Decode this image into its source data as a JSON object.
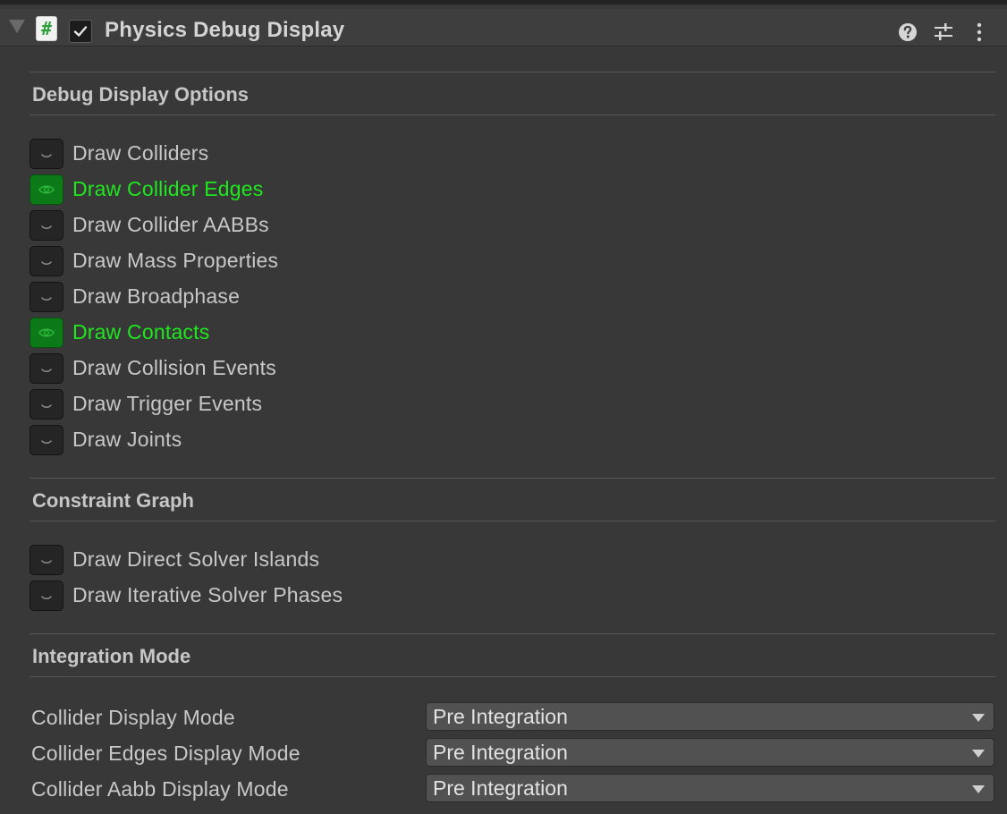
{
  "header": {
    "title": "Physics Debug Display",
    "script_icon_glyph": "#",
    "enabled": true,
    "icons": [
      "triangle-down-icon",
      "script-icon",
      "checkbox-icon",
      "help-icon",
      "sliders-icon",
      "vertical-ellipsis-icon"
    ]
  },
  "sections": {
    "debug_display": {
      "title": "Debug Display Options",
      "items": [
        {
          "label": "Draw Colliders",
          "on": false
        },
        {
          "label": "Draw Collider Edges",
          "on": true
        },
        {
          "label": "Draw Collider AABBs",
          "on": false
        },
        {
          "label": "Draw Mass Properties",
          "on": false
        },
        {
          "label": "Draw Broadphase",
          "on": false
        },
        {
          "label": "Draw Contacts",
          "on": true
        },
        {
          "label": "Draw Collision Events",
          "on": false
        },
        {
          "label": "Draw Trigger Events",
          "on": false
        },
        {
          "label": "Draw Joints",
          "on": false
        }
      ]
    },
    "constraint_graph": {
      "title": "Constraint Graph",
      "items": [
        {
          "label": "Draw Direct Solver Islands",
          "on": false
        },
        {
          "label": "Draw Iterative Solver Phases",
          "on": false
        }
      ]
    },
    "integration_mode": {
      "title": "Integration Mode",
      "fields": [
        {
          "label": "Collider Display Mode",
          "value": "Pre Integration"
        },
        {
          "label": "Collider Edges Display Mode",
          "value": "Pre Integration"
        },
        {
          "label": "Collider Aabb Display Mode",
          "value": "Pre Integration"
        }
      ]
    }
  },
  "colors": {
    "toggle_on_bg": "#0c7a18",
    "toggle_on_text": "#1ee81e",
    "panel_bg": "#383838"
  }
}
